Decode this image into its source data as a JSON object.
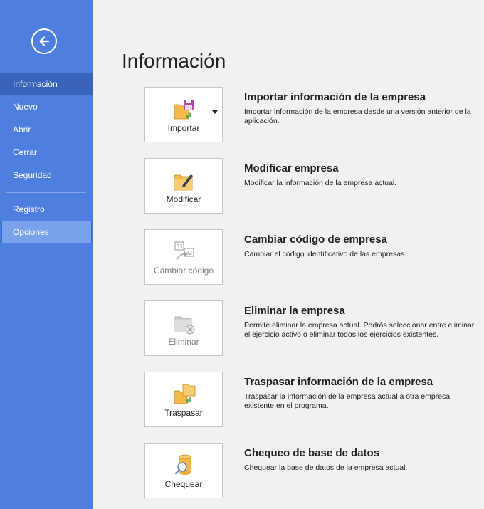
{
  "sidebar": {
    "items": [
      {
        "label": "Información"
      },
      {
        "label": "Nuevo"
      },
      {
        "label": "Abrir"
      },
      {
        "label": "Cerrar"
      },
      {
        "label": "Seguridad"
      },
      {
        "label": "Registro"
      },
      {
        "label": "Opciones"
      }
    ]
  },
  "main": {
    "title": "Información",
    "actions": [
      {
        "tile_label": "Importar",
        "title": "Importar información de la empresa",
        "description": "Importar información de la empresa desde una versión anterior de la aplicación."
      },
      {
        "tile_label": "Modificar",
        "title": "Modificar empresa",
        "description": "Modificar la información de la empresa actual."
      },
      {
        "tile_label": "Cambiar código",
        "title": "Cambiar código de empresa",
        "description": "Cambiar el código identificativo de las empresas."
      },
      {
        "tile_label": "Eliminar",
        "title": "Eliminar la empresa",
        "description": "Permite eliminar la empresa actual. Podrás seleccionar entre eliminar el ejercicio activo o eliminar todos los ejercicios existentes."
      },
      {
        "tile_label": "Traspasar",
        "title": "Traspasar información de la empresa",
        "description": "Traspasar la información de la empresa actual a otra empresa existente en el programa."
      },
      {
        "tile_label": "Chequear",
        "title": "Chequeo de base de datos",
        "description": "Chequear la base de datos de la empresa actual."
      }
    ]
  },
  "colors": {
    "sidebar": "#4f7fde",
    "sidebar_active": "#3a64b9",
    "sidebar_hover": "#7aa2ea",
    "background": "#f1f1f1"
  }
}
